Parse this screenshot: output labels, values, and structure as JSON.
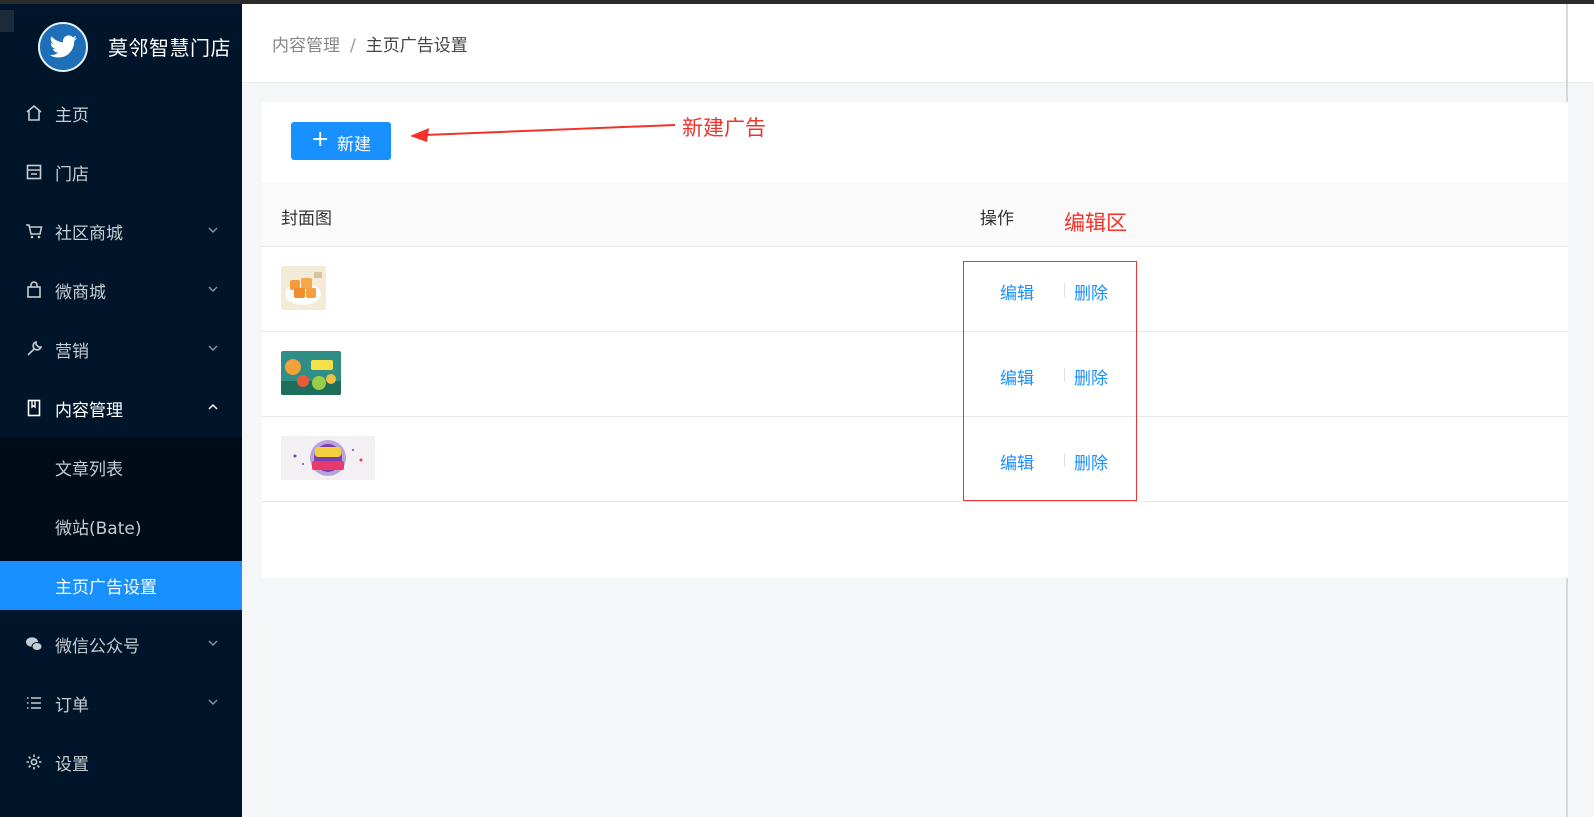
{
  "brand": {
    "name": "莫邻智慧门店"
  },
  "sidebar": {
    "items": [
      {
        "label": "主页",
        "icon": "home-icon"
      },
      {
        "label": "门店",
        "icon": "store-icon"
      },
      {
        "label": "社区商城",
        "icon": "cart-icon",
        "expandable": true
      },
      {
        "label": "微商城",
        "icon": "bag-icon",
        "expandable": true
      },
      {
        "label": "营销",
        "icon": "wrench-icon",
        "expandable": true
      },
      {
        "label": "内容管理",
        "icon": "book-icon",
        "expandable": true,
        "open": true,
        "children": [
          {
            "label": "文章列表"
          },
          {
            "label": "微站(Bate)"
          },
          {
            "label": "主页广告设置",
            "active": true
          }
        ]
      },
      {
        "label": "微信公众号",
        "icon": "wechat-icon",
        "expandable": true
      },
      {
        "label": "订单",
        "icon": "list-icon",
        "expandable": true
      },
      {
        "label": "设置",
        "icon": "gear-icon"
      }
    ]
  },
  "breadcrumb": {
    "parent": "内容管理",
    "separator": "/",
    "current": "主页广告设置"
  },
  "toolbar": {
    "new_button_label": "新建"
  },
  "annotations": {
    "new_ad": "新建广告",
    "edit_area": "编辑区"
  },
  "table": {
    "columns": {
      "cover": "封面图",
      "actions": "操作"
    },
    "rows": [
      {
        "thumb": "orange-dessert-thumbnail",
        "edit": "编辑",
        "delete": "删除"
      },
      {
        "thumb": "fruit-banner-thumbnail",
        "edit": "编辑",
        "delete": "删除"
      },
      {
        "thumb": "618-promo-thumbnail",
        "edit": "编辑",
        "delete": "删除"
      }
    ]
  },
  "colors": {
    "primary": "#1890ff",
    "sidebar": "#001529",
    "annotation": "#f0332a"
  }
}
